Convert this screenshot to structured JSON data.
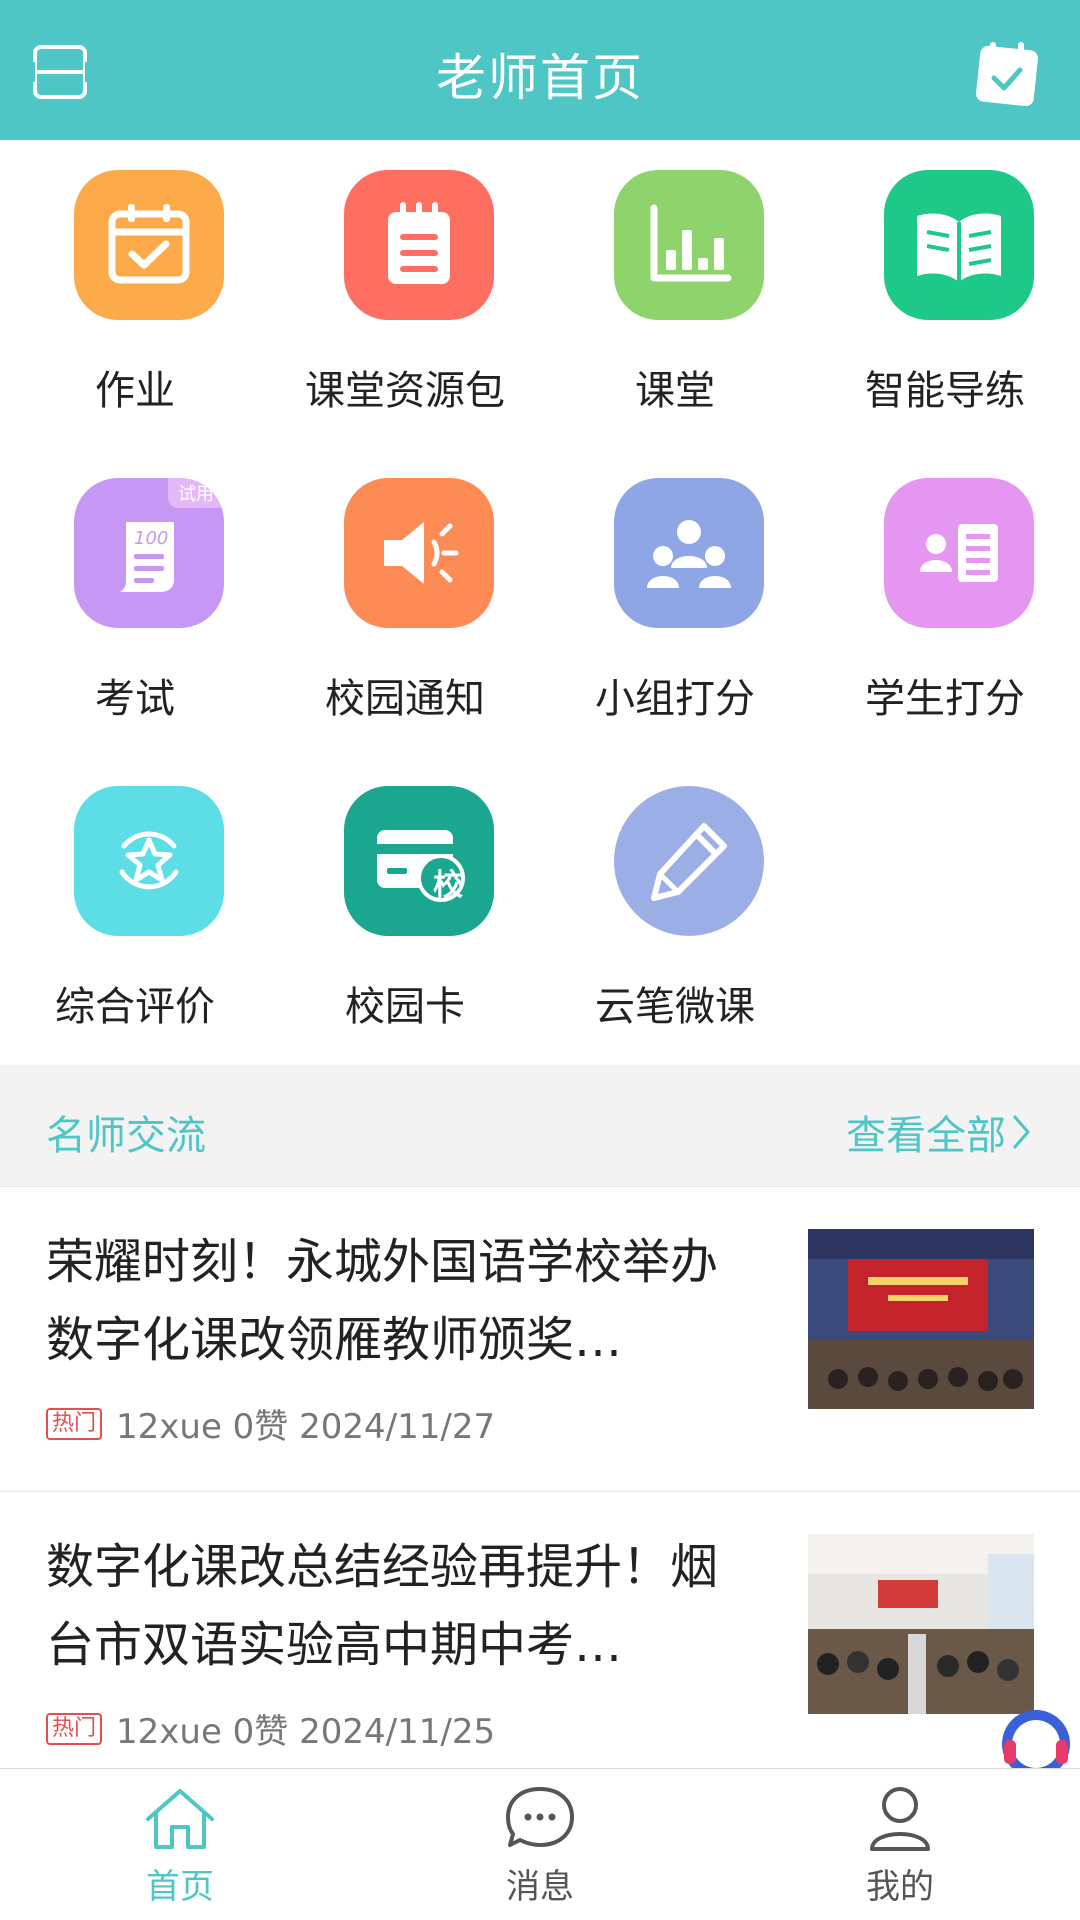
{
  "header": {
    "title": "老师首页"
  },
  "grid": {
    "items": [
      {
        "label": "作业",
        "color": "#fdaa4b",
        "icon": "calendar-check-icon"
      },
      {
        "label": "课堂资源包",
        "color": "#fe6f61",
        "icon": "notepad-icon"
      },
      {
        "label": "课堂",
        "color": "#8ed36c",
        "icon": "bar-chart-icon"
      },
      {
        "label": "智能导练",
        "color": "#1ec889",
        "icon": "open-book-icon"
      },
      {
        "label": "考试",
        "color": "#c797f6",
        "icon": "exam-paper-icon",
        "badge": "试用"
      },
      {
        "label": "校园通知",
        "color": "#fd8b55",
        "icon": "speaker-icon"
      },
      {
        "label": "小组打分",
        "color": "#8fa6e6",
        "icon": "group-icon"
      },
      {
        "label": "学生打分",
        "color": "#e596f0",
        "icon": "student-card-icon"
      },
      {
        "label": "综合评价",
        "color": "#5ddde6",
        "icon": "star-badge-icon"
      },
      {
        "label": "校园卡",
        "color": "#1aa68f",
        "icon": "school-card-icon",
        "card_text": "校"
      },
      {
        "label": "云笔微课",
        "color": "#9caee6",
        "icon": "pencil-icon"
      }
    ]
  },
  "section": {
    "title": "名师交流",
    "more_label": "查看全部"
  },
  "news": [
    {
      "headline": "荣耀时刻！永城外国语学校举办数字化课改领雁教师颁奖…",
      "badge": "热门",
      "meta": "12xue 0赞 2024/11/27"
    },
    {
      "headline": "数字化课改总结经验再提升！烟台市双语实验高中期中考…",
      "badge": "热门",
      "meta": "12xue 0赞 2024/11/25"
    }
  ],
  "bottom_nav": [
    {
      "label": "首页",
      "icon": "home-icon",
      "active": true
    },
    {
      "label": "消息",
      "icon": "chat-icon",
      "active": false
    },
    {
      "label": "我的",
      "icon": "person-icon",
      "active": false
    }
  ],
  "colors": {
    "accent": "#4ec6c6",
    "hot_badge": "#e05050"
  }
}
